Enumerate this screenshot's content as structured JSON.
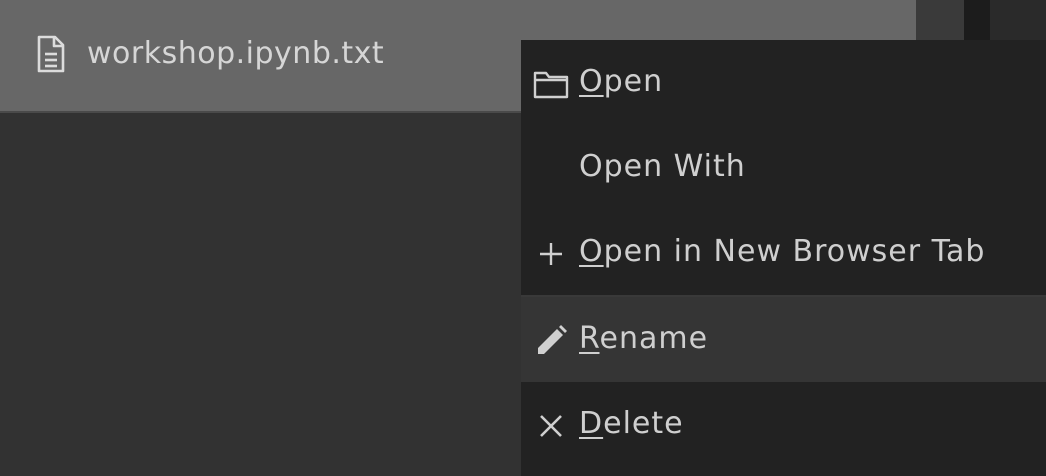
{
  "file": {
    "name": "workshop.ipynb.txt",
    "icon": "file-text-icon"
  },
  "context_menu": {
    "items": [
      {
        "mnemonic": "O",
        "rest": "pen",
        "icon": "folder-icon"
      },
      {
        "label": "Open With"
      },
      {
        "mnemonic": "O",
        "rest": "pen in New Browser Tab",
        "icon": "plus-icon"
      },
      {
        "mnemonic": "R",
        "rest": "ename",
        "icon": "pencil-icon"
      },
      {
        "mnemonic": "D",
        "rest": "elete",
        "icon": "close-icon"
      }
    ]
  },
  "colors": {
    "background": "#323232",
    "file_row": "#676767",
    "menu_bg": "#222222",
    "menu_hover": "#353535",
    "text": "#cfcfcf"
  }
}
